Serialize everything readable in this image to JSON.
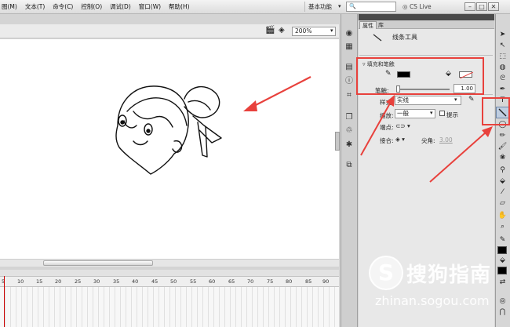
{
  "menubar": {
    "items": [
      "图(M)",
      "文本(T)",
      "命令(C)",
      "控制(O)",
      "调试(D)",
      "窗口(W)",
      "帮助(H)"
    ],
    "workspace": "基本功能",
    "cs_live": "CS Live"
  },
  "stage": {
    "zoom": "200%"
  },
  "timeline": {
    "ticks": [
      "5",
      "10",
      "15",
      "20",
      "25",
      "30",
      "35",
      "40",
      "45",
      "50",
      "55",
      "60",
      "65",
      "70",
      "75",
      "80",
      "85",
      "90"
    ]
  },
  "panel": {
    "tabs": [
      "属性",
      "库"
    ],
    "tool_name": "线条工具",
    "fill_stroke_header": "填充和笔触",
    "stroke_label": "笔触:",
    "stroke_value": "1.00",
    "style_label": "样式:",
    "style_value": "实线",
    "scale_label": "缩放:",
    "scale_value": "一般",
    "hint_label": "提示",
    "cap_label": "端点:",
    "join_label": "接合:",
    "miter_label": "尖角:",
    "miter_value": "3.00"
  },
  "colors": {
    "stroke": "#000000",
    "annotation": "#e8413c"
  },
  "watermark": {
    "brand": "搜狗指南",
    "url": "zhinan.sogou.com"
  }
}
